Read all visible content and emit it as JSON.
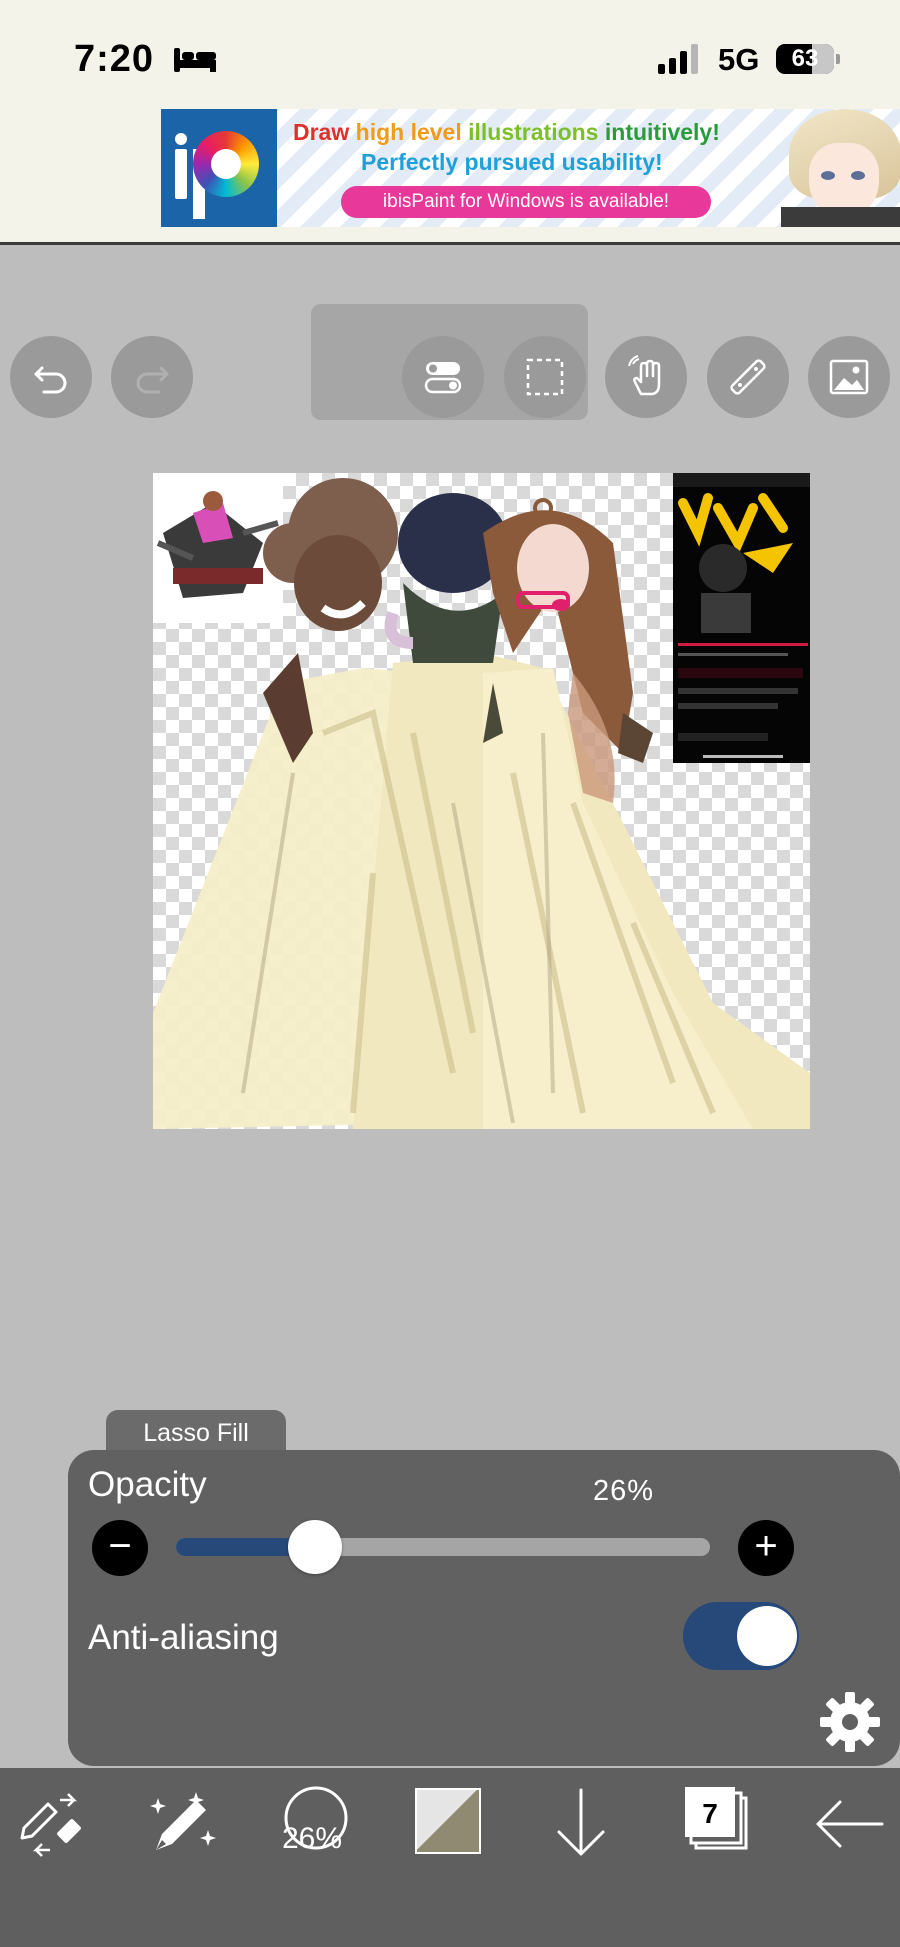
{
  "status_bar": {
    "time": "7:20",
    "network": "5G",
    "battery": "63"
  },
  "ad": {
    "line1_words": [
      {
        "text": "Draw ",
        "color": "#e0302b"
      },
      {
        "text": "high level ",
        "color": "#f29a1a"
      },
      {
        "text": "illustrations ",
        "color": "#7cbf2b"
      },
      {
        "text": "intuitively!",
        "color": "#2a9a3a"
      }
    ],
    "line2": "Perfectly pursued usability!",
    "pill": "ibisPaint for Windows is available!"
  },
  "toolbar": {
    "icons": [
      "undo-icon",
      "redo-icon",
      "toggle-icon",
      "selection-icon",
      "hand-icon",
      "ruler-icon",
      "image-icon"
    ]
  },
  "brush_panel": {
    "tab_label": "Lasso Fill",
    "opacity_label": "Opacity",
    "opacity_value": "26%",
    "opacity_fraction": 0.26,
    "minus_label": "−",
    "plus_label": "+",
    "antialiasing_label": "Anti-aliasing",
    "antialiasing_on": true
  },
  "bottom_bar": {
    "brush_size": "26%",
    "layer_count": "7",
    "icons": [
      "tool-swap-icon",
      "magic-brush-icon",
      "brush-size-icon",
      "color-swatch",
      "download-arrow-icon",
      "layers-icon",
      "back-arrow-icon"
    ]
  },
  "colors": {
    "accent": "#27497a",
    "panel": "#616161",
    "bottom_bar": "#5f5f5f",
    "workspace": "#bdbdbd"
  }
}
